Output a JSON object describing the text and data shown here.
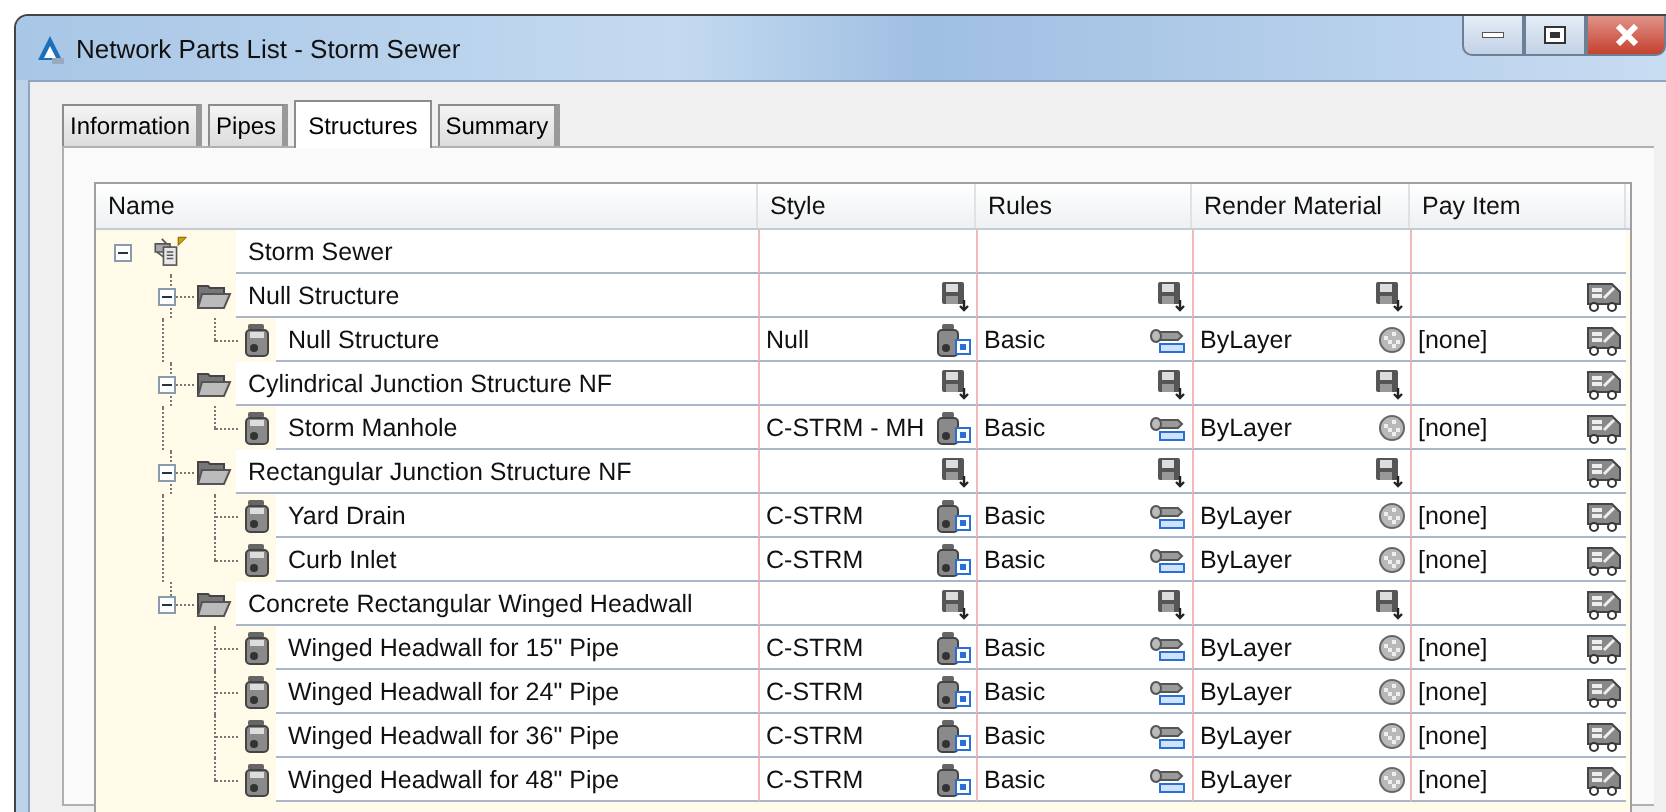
{
  "window": {
    "title": "Network Parts List - Storm Sewer"
  },
  "tabs": [
    {
      "label": "Information",
      "selected": false
    },
    {
      "label": "Pipes",
      "selected": false
    },
    {
      "label": "Structures",
      "selected": true
    },
    {
      "label": "Summary",
      "selected": false
    }
  ],
  "table": {
    "columns": [
      "Name",
      "Style",
      "Rules",
      "Render Material",
      "Pay Item"
    ],
    "rows": [
      {
        "kind": "network",
        "name": "Storm Sewer",
        "expanded": true,
        "children": [
          {
            "kind": "family",
            "name": "Null Structure",
            "expanded": true,
            "children": [
              {
                "kind": "part",
                "name": "Null Structure",
                "style": "Null",
                "rules": "Basic",
                "render_material": "ByLayer",
                "pay_item": "[none]"
              }
            ]
          },
          {
            "kind": "family",
            "name": "Cylindrical Junction Structure NF",
            "expanded": true,
            "children": [
              {
                "kind": "part",
                "name": "Storm Manhole",
                "style": "C-STRM - MH",
                "rules": "Basic",
                "render_material": "ByLayer",
                "pay_item": "[none]"
              }
            ]
          },
          {
            "kind": "family",
            "name": "Rectangular Junction Structure NF",
            "expanded": true,
            "children": [
              {
                "kind": "part",
                "name": "Yard Drain",
                "style": "C-STRM",
                "rules": "Basic",
                "render_material": "ByLayer",
                "pay_item": "[none]"
              },
              {
                "kind": "part",
                "name": "Curb Inlet",
                "style": "C-STRM",
                "rules": "Basic",
                "render_material": "ByLayer",
                "pay_item": "[none]"
              }
            ]
          },
          {
            "kind": "family",
            "name": "Concrete Rectangular Winged Headwall",
            "expanded": true,
            "children": [
              {
                "kind": "part",
                "name": "Winged Headwall for 15\" Pipe",
                "style": "C-STRM",
                "rules": "Basic",
                "render_material": "ByLayer",
                "pay_item": "[none]"
              },
              {
                "kind": "part",
                "name": "Winged Headwall for 24\" Pipe",
                "style": "C-STRM",
                "rules": "Basic",
                "render_material": "ByLayer",
                "pay_item": "[none]"
              },
              {
                "kind": "part",
                "name": "Winged Headwall for 36\" Pipe",
                "style": "C-STRM",
                "rules": "Basic",
                "render_material": "ByLayer",
                "pay_item": "[none]"
              },
              {
                "kind": "part",
                "name": "Winged Headwall for 48\" Pipe",
                "style": "C-STRM",
                "rules": "Basic",
                "render_material": "ByLayer",
                "pay_item": "[none]"
              }
            ]
          }
        ]
      }
    ]
  }
}
